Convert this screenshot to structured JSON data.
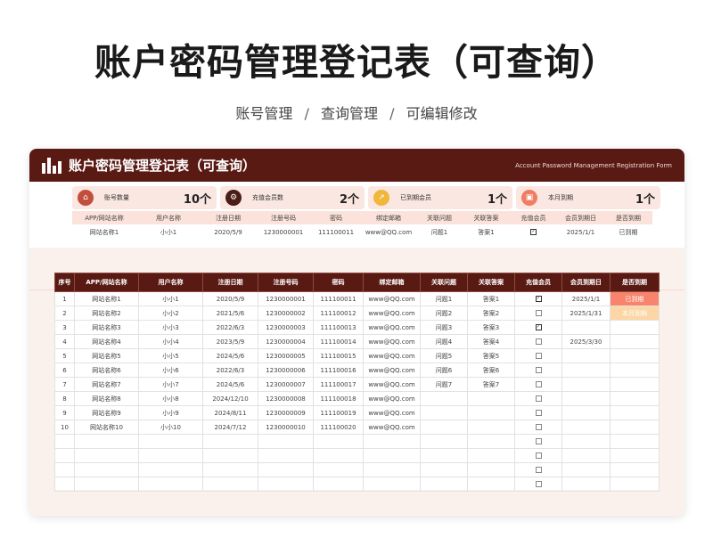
{
  "page": {
    "title": "账户密码管理登记表（可查询）",
    "breadcrumb": [
      "账号管理",
      "查询管理",
      "可编辑修改"
    ],
    "breadcrumb_sep": "/"
  },
  "card": {
    "title": "账户密码管理登记表（可查询）",
    "subtitle": "Account Password Management Registration Form"
  },
  "stats": [
    {
      "label": "账号数量",
      "value": "10个",
      "icon": "home-icon",
      "color": "#c0503d"
    },
    {
      "label": "充值会员数",
      "value": "2个",
      "icon": "gear-icon",
      "color": "#4a1d17"
    },
    {
      "label": "已到期会员",
      "value": "1个",
      "icon": "chart-icon",
      "color": "#f0b73a"
    },
    {
      "label": "本月到期",
      "value": "1个",
      "icon": "calendar-icon",
      "color": "#f07d62"
    }
  ],
  "mini_table": {
    "headers": [
      "APP/网站名称",
      "用户名称",
      "注册日期",
      "注册号码",
      "密码",
      "绑定邮箱",
      "关联问题",
      "关联答案",
      "充值会员",
      "会员到期日",
      "是否到期"
    ],
    "row": [
      "网站名称1",
      "小小1",
      "2020/5/9",
      "1230000001",
      "111100011",
      "www@QQ.com",
      "问题1",
      "答案1",
      "checked",
      "2025/1/1",
      "已到期"
    ]
  },
  "main_table": {
    "headers": [
      "序号",
      "APP/网站名称",
      "用户名称",
      "注册日期",
      "注册号码",
      "密码",
      "绑定邮箱",
      "关联问题",
      "关联答案",
      "充值会员",
      "会员到期日",
      "是否到期"
    ],
    "rows": [
      [
        "1",
        "网站名称1",
        "小小1",
        "2020/5/9",
        "1230000001",
        "111100011",
        "www@QQ.com",
        "问题1",
        "答案1",
        "checked",
        "2025/1/1",
        "已到期"
      ],
      [
        "2",
        "网站名称2",
        "小小2",
        "2021/5/6",
        "1230000002",
        "111100012",
        "www@QQ.com",
        "问题2",
        "答案2",
        "unchecked",
        "2025/1/31",
        "本月到期"
      ],
      [
        "3",
        "网站名称3",
        "小小3",
        "2022/6/3",
        "1230000003",
        "111100013",
        "www@QQ.com",
        "问题3",
        "答案3",
        "checked",
        "",
        ""
      ],
      [
        "4",
        "网站名称4",
        "小小4",
        "2023/5/9",
        "1230000004",
        "111100014",
        "www@QQ.com",
        "问题4",
        "答案4",
        "unchecked",
        "2025/3/30",
        ""
      ],
      [
        "5",
        "网站名称5",
        "小小5",
        "2024/5/6",
        "1230000005",
        "111100015",
        "www@QQ.com",
        "问题5",
        "答案5",
        "unchecked",
        "",
        ""
      ],
      [
        "6",
        "网站名称6",
        "小小6",
        "2022/6/3",
        "1230000006",
        "111100016",
        "www@QQ.com",
        "问题6",
        "答案6",
        "unchecked",
        "",
        ""
      ],
      [
        "7",
        "网站名称7",
        "小小7",
        "2024/5/6",
        "1230000007",
        "111100017",
        "www@QQ.com",
        "问题7",
        "答案7",
        "unchecked",
        "",
        ""
      ],
      [
        "8",
        "网站名称8",
        "小小8",
        "2024/12/10",
        "1230000008",
        "111100018",
        "www@QQ.com",
        "",
        "",
        "unchecked",
        "",
        ""
      ],
      [
        "9",
        "网站名称9",
        "小小9",
        "2024/8/11",
        "1230000009",
        "111100019",
        "www@QQ.com",
        "",
        "",
        "unchecked",
        "",
        ""
      ],
      [
        "10",
        "网站名称10",
        "小小10",
        "2024/7/12",
        "1230000010",
        "111100020",
        "www@QQ.com",
        "",
        "",
        "unchecked",
        "",
        ""
      ],
      [
        "",
        "",
        "",
        "",
        "",
        "",
        "",
        "",
        "",
        "unchecked",
        "",
        ""
      ],
      [
        "",
        "",
        "",
        "",
        "",
        "",
        "",
        "",
        "",
        "unchecked",
        "",
        ""
      ],
      [
        "",
        "",
        "",
        "",
        "",
        "",
        "",
        "",
        "",
        "unchecked",
        "",
        ""
      ],
      [
        "",
        "",
        "",
        "",
        "",
        "",
        "",
        "",
        "",
        "unchecked",
        "",
        ""
      ]
    ],
    "expired_color": "#f8846d",
    "this_month_color": "#fcd6a4"
  }
}
